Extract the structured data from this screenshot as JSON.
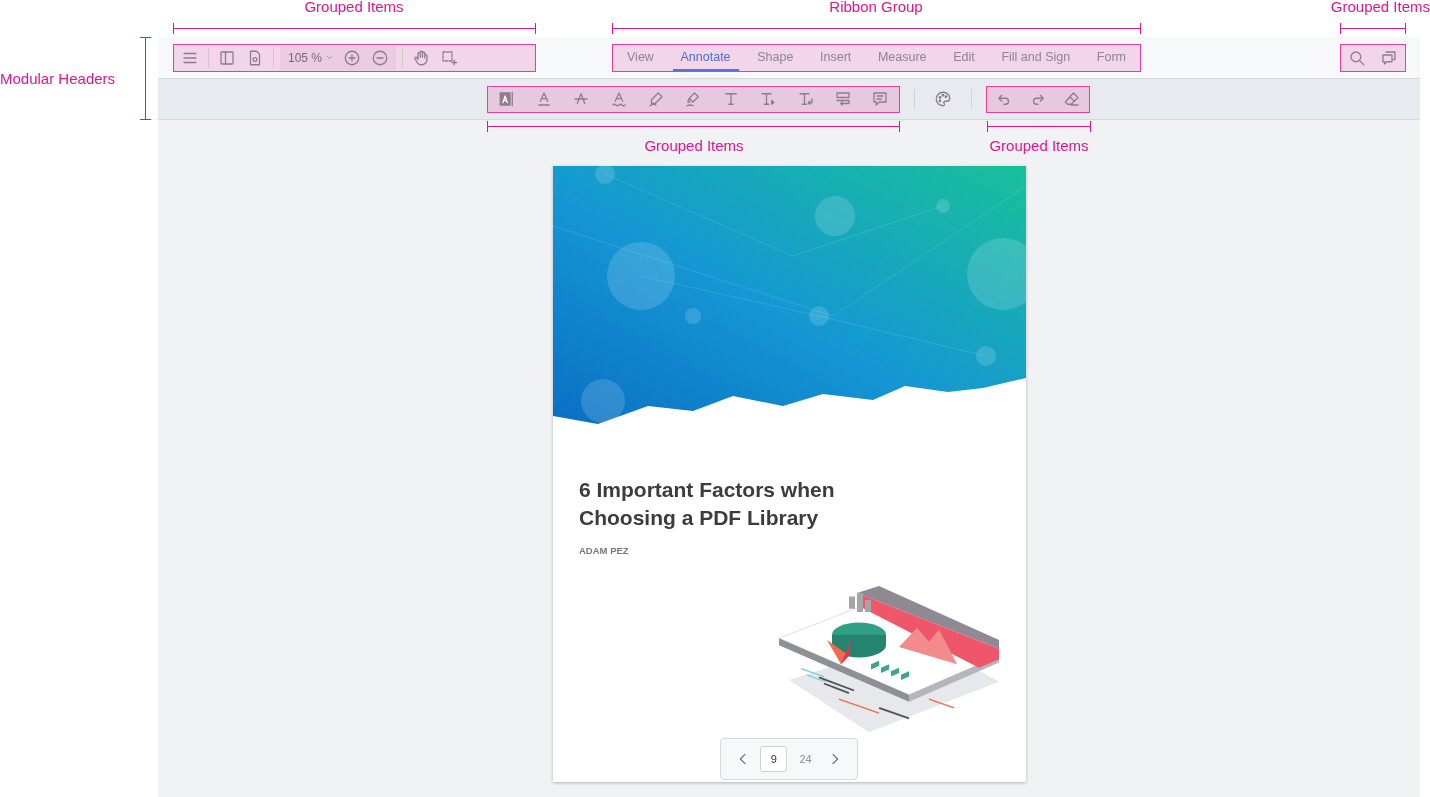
{
  "annotations": [
    {
      "label": "Grouped Items"
    },
    {
      "label": "Ribbon Group"
    },
    {
      "label": "Grouped Items"
    },
    {
      "label": "Modular Headers"
    },
    {
      "label": "Grouped Items"
    },
    {
      "label": "Grouped Items"
    }
  ],
  "header": {
    "zoom": {
      "value": "105 %"
    }
  },
  "ribbon": {
    "tabs": [
      {
        "label": "View",
        "selected": false
      },
      {
        "label": "Annotate",
        "selected": true
      },
      {
        "label": "Shape",
        "selected": false
      },
      {
        "label": "Insert",
        "selected": false
      },
      {
        "label": "Measure",
        "selected": false
      },
      {
        "label": "Edit",
        "selected": false
      },
      {
        "label": "Fill and Sign",
        "selected": false
      },
      {
        "label": "Form",
        "selected": false
      }
    ]
  },
  "document": {
    "title": "6 Important Factors when Choosing a PDF Library",
    "author": "ADAM PEZ"
  },
  "pagination": {
    "current": "9",
    "total": "24"
  }
}
